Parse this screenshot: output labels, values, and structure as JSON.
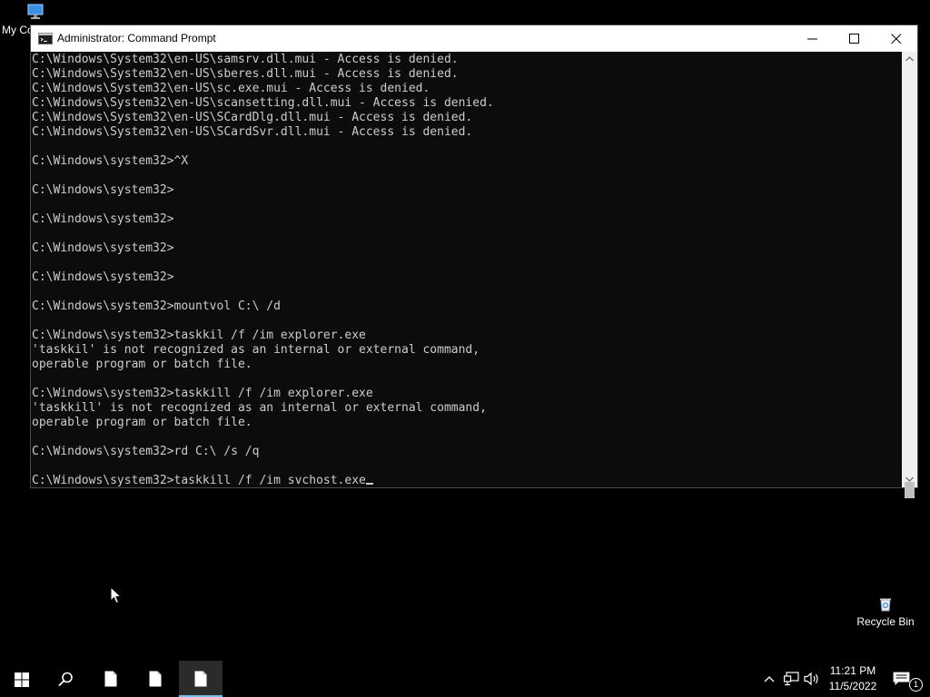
{
  "desktop": {
    "icons": [
      {
        "label": "My Co",
        "icon": "monitor-icon"
      },
      {
        "label": "Recycle Bin",
        "icon": "recycle-bin-icon"
      }
    ]
  },
  "window": {
    "title": "Administrator: Command Prompt",
    "icon": "cmd-icon",
    "console_lines": [
      "C:\\Windows\\System32\\en-US\\samsrv.dll.mui - Access is denied.",
      "C:\\Windows\\System32\\en-US\\sberes.dll.mui - Access is denied.",
      "C:\\Windows\\System32\\en-US\\sc.exe.mui - Access is denied.",
      "C:\\Windows\\System32\\en-US\\scansetting.dll.mui - Access is denied.",
      "C:\\Windows\\System32\\en-US\\SCardDlg.dll.mui - Access is denied.",
      "C:\\Windows\\System32\\en-US\\SCardSvr.dll.mui - Access is denied.",
      "",
      "C:\\Windows\\system32>^X",
      "",
      "C:\\Windows\\system32>",
      "",
      "C:\\Windows\\system32>",
      "",
      "C:\\Windows\\system32>",
      "",
      "C:\\Windows\\system32>",
      "",
      "C:\\Windows\\system32>mountvol C:\\ /d",
      "",
      "C:\\Windows\\system32>taskkil /f /im explorer.exe",
      "'taskkil' is not recognized as an internal or external command,",
      "operable program or batch file.",
      "",
      "C:\\Windows\\system32>taskkill /f /im explorer.exe",
      "'taskkill' is not recognized as an internal or external command,",
      "operable program or batch file.",
      "",
      "C:\\Windows\\system32>rd C:\\ /s /q",
      ""
    ],
    "current_input": "C:\\Windows\\system32>taskkill /f /im svchost.exe"
  },
  "taskbar": {
    "clock_time": "11:21 PM",
    "clock_date": "11/5/2022",
    "notification_count": "1"
  },
  "colors": {
    "console_bg": "#0c0c0c",
    "console_fg": "#cccccc",
    "taskbar_bg": "#000000",
    "active_task_accent": "#76b9ed"
  }
}
